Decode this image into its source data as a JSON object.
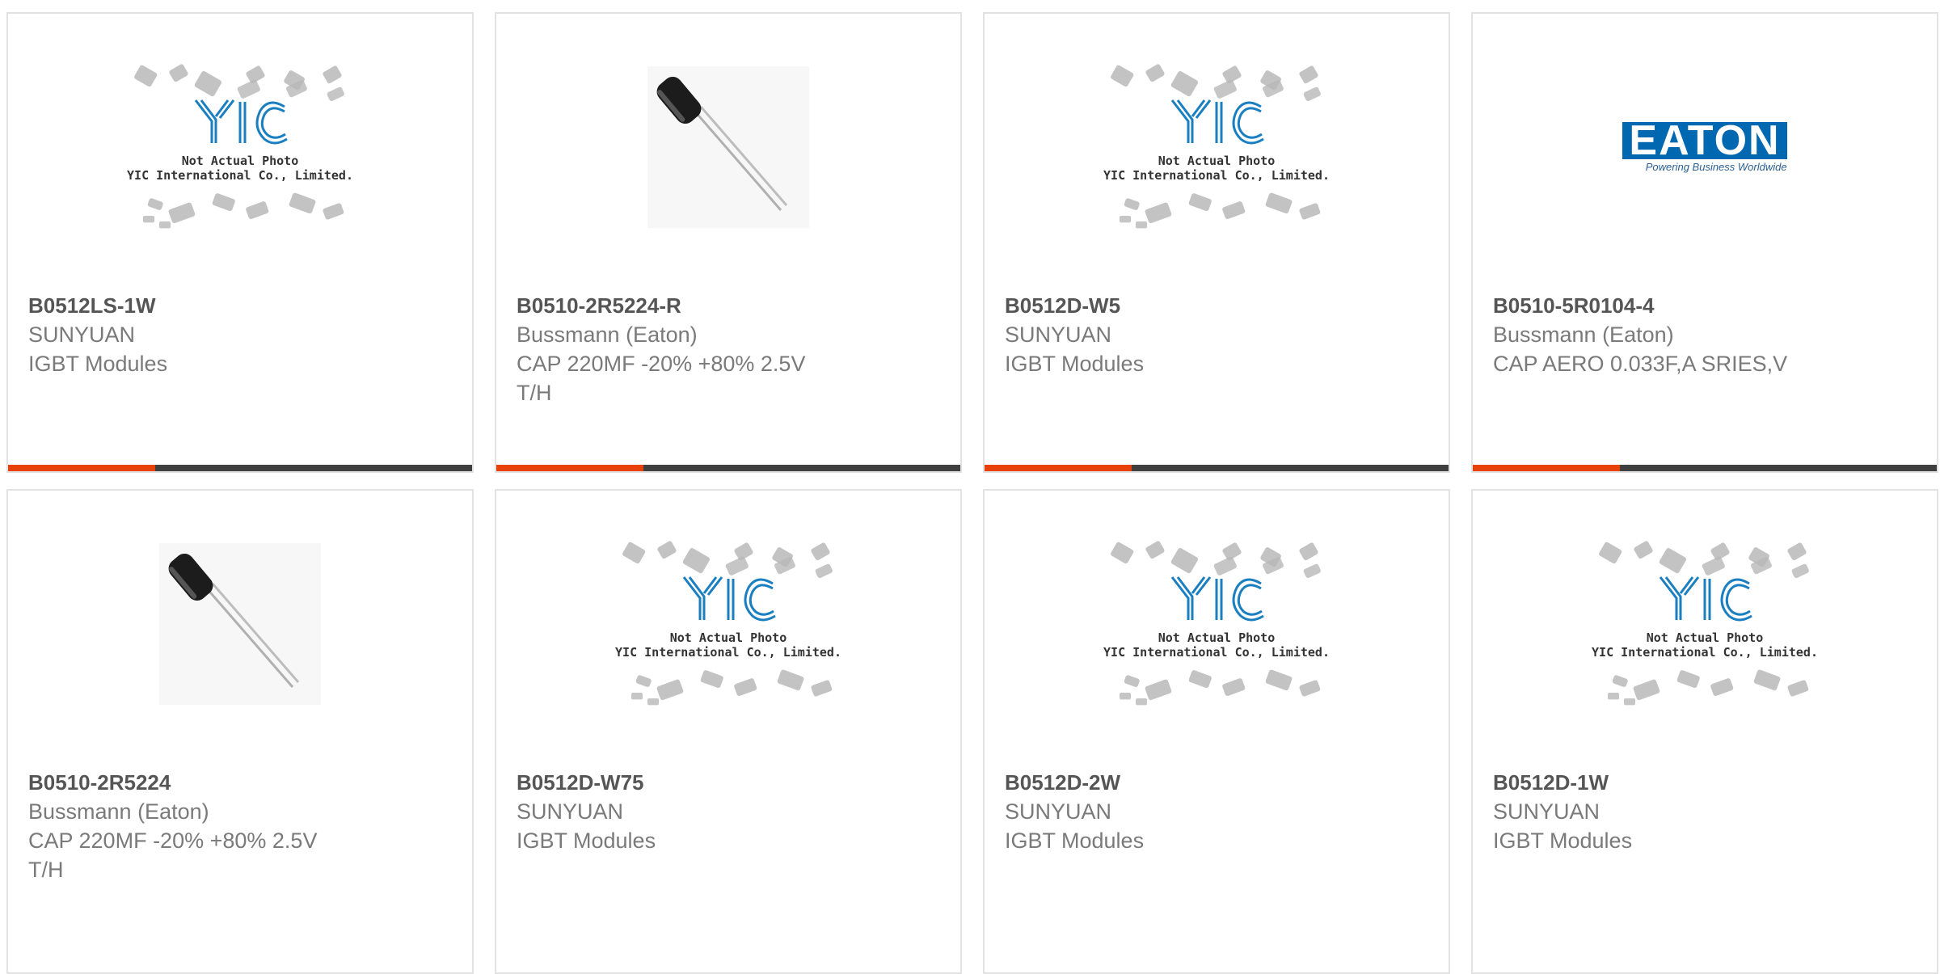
{
  "products": [
    {
      "part_number": "B0512LS-1W",
      "brand": "SUNYUAN",
      "description": "IGBT Modules",
      "image": "yic-placeholder",
      "image_caption_1": "Not Actual Photo",
      "image_caption_2": "YIC International Co., Limited."
    },
    {
      "part_number": "B0510-2R5224-R",
      "brand": "Bussmann (Eaton)",
      "description": "CAP 220MF -20% +80% 2.5V T/H",
      "image": "capacitor-photo"
    },
    {
      "part_number": "B0512D-W5",
      "brand": "SUNYUAN",
      "description": "IGBT Modules",
      "image": "yic-placeholder",
      "image_caption_1": "Not Actual Photo",
      "image_caption_2": "YIC International Co., Limited."
    },
    {
      "part_number": "B0510-5R0104-4",
      "brand": "Bussmann (Eaton)",
      "description": "CAP AERO 0.033F,A SRIES,V",
      "image": "eaton-logo",
      "logo_text": "EATON",
      "logo_tagline": "Powering Business Worldwide"
    },
    {
      "part_number": "B0510-2R5224",
      "brand": "Bussmann (Eaton)",
      "description": "CAP 220MF -20% +80% 2.5V T/H",
      "image": "capacitor-photo"
    },
    {
      "part_number": "B0512D-W75",
      "brand": "SUNYUAN",
      "description": "IGBT Modules",
      "image": "yic-placeholder",
      "image_caption_1": "Not Actual Photo",
      "image_caption_2": "YIC International Co., Limited."
    },
    {
      "part_number": "B0512D-2W",
      "brand": "SUNYUAN",
      "description": "IGBT Modules",
      "image": "yic-placeholder",
      "image_caption_1": "Not Actual Photo",
      "image_caption_2": "YIC International Co., Limited."
    },
    {
      "part_number": "B0512D-1W",
      "brand": "SUNYUAN",
      "description": "IGBT Modules",
      "image": "yic-placeholder",
      "image_caption_1": "Not Actual Photo",
      "image_caption_2": "YIC International Co., Limited."
    }
  ],
  "colors": {
    "accent": "#e8420a",
    "bar": "#3f3f3f",
    "yic_blue": "#1a7fc1",
    "eaton_blue": "#0067b1",
    "chip_gray": "#b8b8b8"
  }
}
